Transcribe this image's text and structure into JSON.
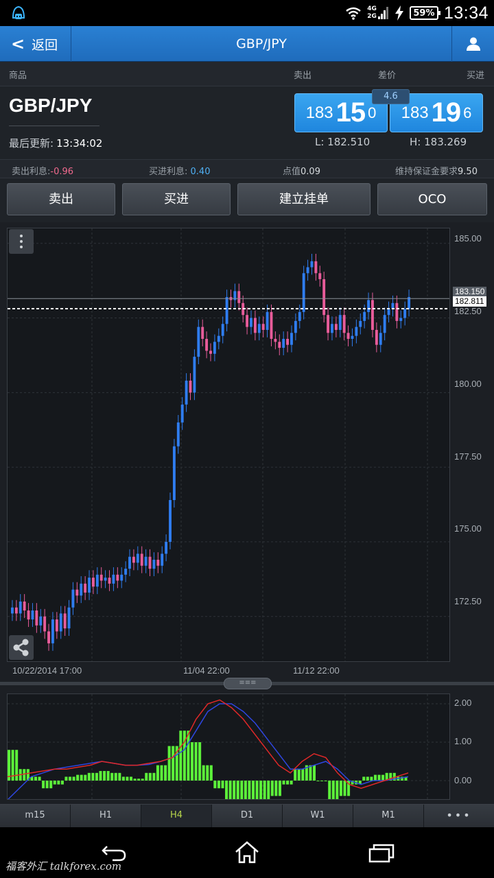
{
  "status_bar": {
    "network": [
      "4G",
      "2G"
    ],
    "battery": "59%",
    "time": "13:34"
  },
  "header": {
    "back_label": "返回",
    "title": "GBP/JPY"
  },
  "columns": {
    "product": "商品",
    "sell": "卖出",
    "spread": "差价",
    "buy": "买进"
  },
  "quote": {
    "symbol": "GBP/JPY",
    "updated_label": "最后更新:",
    "updated_time": "13:34:02",
    "sell": {
      "prefix": "183",
      "big": "15",
      "last": "0"
    },
    "buy": {
      "prefix": "183",
      "big": "19",
      "last": "6"
    },
    "spread": "4.6",
    "low": "L: 182.510",
    "high": "H: 183.269"
  },
  "info": {
    "sell_interest_label": "卖出利息:",
    "sell_interest": "-0.96",
    "buy_interest_label": "买进利息:",
    "buy_interest": "0.40",
    "pip_label": "点值",
    "pip_value": "0.09",
    "margin_label": "维持保证金要求",
    "margin_value": "9.50"
  },
  "actions": {
    "sell": "卖出",
    "buy": "买进",
    "pending": "建立挂单",
    "oco": "OCO"
  },
  "chart": {
    "y_ticks": [
      "185.00",
      "182.50",
      "180.00",
      "177.50",
      "175.00",
      "172.50"
    ],
    "x_ticks": [
      "10/22/2014  17:00",
      "11/04  22:00",
      "11/12  22:00"
    ],
    "current_sell": "183.150",
    "current_line": "182.811",
    "colors": {
      "up": "#2f7df0",
      "down": "#e85c9a"
    }
  },
  "indicator": {
    "y_ticks": [
      "2.00",
      "1.00",
      "0.00"
    ]
  },
  "timeframes": {
    "items": [
      "m15",
      "H1",
      "H4",
      "D1",
      "W1",
      "M1",
      "•••"
    ],
    "active": "H4"
  },
  "watermark": "福客外汇 talkforex.com",
  "chart_data": {
    "type": "candlestick",
    "title": "",
    "ylim": [
      171.0,
      185.5
    ],
    "y_ticks": [
      185.0,
      182.5,
      180.0,
      177.5,
      175.0,
      172.5
    ],
    "x_labels": [
      "10/22/2014 17:00",
      "11/04 22:00",
      "11/12 22:00"
    ],
    "close": [
      172.8,
      172.6,
      173.0,
      172.7,
      172.4,
      172.7,
      172.2,
      172.5,
      172.0,
      171.6,
      172.4,
      172.0,
      172.6,
      172.1,
      172.8,
      173.4,
      173.2,
      173.6,
      173.3,
      173.8,
      173.5,
      173.9,
      173.7,
      173.8,
      173.6,
      173.9,
      173.7,
      173.9,
      174.1,
      174.5,
      174.3,
      174.6,
      174.2,
      174.5,
      174.1,
      174.4,
      174.2,
      174.6,
      175.0,
      176.4,
      178.2,
      179.0,
      179.6,
      180.4,
      180.0,
      181.2,
      182.2,
      181.8,
      181.4,
      181.3,
      181.7,
      181.9,
      182.3,
      183.2,
      183.1,
      183.4,
      183.0,
      182.6,
      182.2,
      182.5,
      182.0,
      182.3,
      182.1,
      182.7,
      181.8,
      181.7,
      181.5,
      181.8,
      181.6,
      182.0,
      182.4,
      182.7,
      184.0,
      184.2,
      184.4,
      184.0,
      183.8,
      182.6,
      182.0,
      182.3,
      182.1,
      182.6,
      182.0,
      181.8,
      181.9,
      182.2,
      182.4,
      182.7,
      183.1,
      182.1,
      181.6,
      182.0,
      182.6,
      182.8,
      183.0,
      182.4,
      182.5,
      182.8,
      183.2
    ],
    "indicator": {
      "macd_line": [
        0.1,
        0.15,
        0.2,
        0.25,
        0.3,
        0.3,
        0.35,
        0.4,
        0.5,
        0.45,
        0.4,
        0.4,
        0.45,
        0.5,
        0.6,
        1.0,
        1.6,
        2.0,
        2.1,
        1.9,
        1.6,
        1.2,
        0.8,
        0.4,
        0.2,
        0.5,
        0.7,
        0.6,
        0.2,
        -0.1,
        -0.2,
        -0.1,
        0.0,
        0.1,
        0.2
      ],
      "signal_line": [
        -0.5,
        -0.2,
        0.1,
        0.2,
        0.3,
        0.35,
        0.4,
        0.45,
        0.5,
        0.45,
        0.4,
        0.4,
        0.42,
        0.5,
        0.6,
        0.8,
        1.3,
        1.8,
        2.0,
        2.0,
        1.8,
        1.5,
        1.1,
        0.7,
        0.3,
        0.3,
        0.4,
        0.5,
        0.3,
        0.0,
        -0.1,
        0.0,
        0.0,
        0.05,
        0.1
      ],
      "histogram": [
        0.8,
        0.3,
        0.1,
        -0.2,
        -0.1,
        0.1,
        0.15,
        0.2,
        0.25,
        0.2,
        0.1,
        0.05,
        0.2,
        0.4,
        0.9,
        1.3,
        1.0,
        0.4,
        -0.2,
        -0.5,
        -0.6,
        -0.7,
        -0.6,
        -0.4,
        -0.1,
        0.3,
        0.4,
        0.0,
        -0.5,
        -0.4,
        -0.1,
        0.1,
        0.15,
        0.2,
        0.1
      ]
    }
  }
}
